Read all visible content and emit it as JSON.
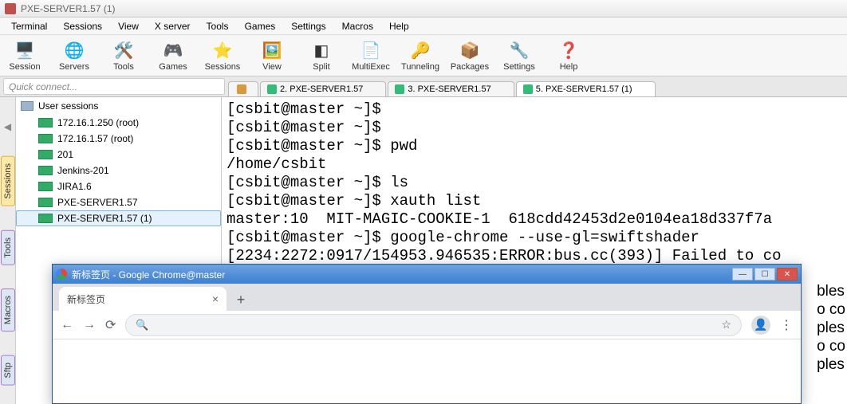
{
  "window": {
    "title": "PXE-SERVER1.57 (1)"
  },
  "menu": [
    "Terminal",
    "Sessions",
    "View",
    "X server",
    "Tools",
    "Games",
    "Settings",
    "Macros",
    "Help"
  ],
  "toolbar": [
    {
      "name": "session",
      "label": "Session",
      "glyph": "🖥️"
    },
    {
      "name": "servers",
      "label": "Servers",
      "glyph": "🌐"
    },
    {
      "name": "tools",
      "label": "Tools",
      "glyph": "🛠️"
    },
    {
      "name": "games",
      "label": "Games",
      "glyph": "🎮"
    },
    {
      "name": "sessions",
      "label": "Sessions",
      "glyph": "⭐"
    },
    {
      "name": "view",
      "label": "View",
      "glyph": "🖼️"
    },
    {
      "name": "split",
      "label": "Split",
      "glyph": "◧"
    },
    {
      "name": "multiexec",
      "label": "MultiExec",
      "glyph": "📄"
    },
    {
      "name": "tunneling",
      "label": "Tunneling",
      "glyph": "🔑"
    },
    {
      "name": "packages",
      "label": "Packages",
      "glyph": "📦"
    },
    {
      "name": "settings",
      "label": "Settings",
      "glyph": "🔧"
    },
    {
      "name": "help",
      "label": "Help",
      "glyph": "❓"
    }
  ],
  "quick_connect_placeholder": "Quick connect...",
  "tabs": [
    {
      "id": "home",
      "label": "",
      "home": true
    },
    {
      "id": "t2",
      "label": "2. PXE-SERVER1.57"
    },
    {
      "id": "t3",
      "label": "3. PXE-SERVER1.57"
    },
    {
      "id": "t5",
      "label": "5. PXE-SERVER1.57 (1)",
      "active": true
    }
  ],
  "sidetabs": [
    "Sessions",
    "Tools",
    "Macros",
    "Sftp"
  ],
  "tree": {
    "head": "User sessions",
    "items": [
      "172.16.1.250 (root)",
      "172.16.1.57 (root)",
      "201",
      "Jenkins-201",
      "JIRA1.6",
      "PXE-SERVER1.57",
      "PXE-SERVER1.57 (1)"
    ],
    "selected_index": 6
  },
  "terminal": {
    "lines": [
      "[csbit@master ~]$",
      "[csbit@master ~]$",
      "[csbit@master ~]$ pwd",
      "/home/csbit",
      "[csbit@master ~]$ ls",
      "[csbit@master ~]$ xauth list",
      "master:10  MIT-MAGIC-COOKIE-1  618cdd42453d2e0104ea18d337f7a",
      "[csbit@master ~]$ google-chrome --use-gl=swiftshader"
    ],
    "partial": "[2234:2272:0917/154953.946535:ERROR:bus.cc(393)] Failed to co",
    "rframes": [
      "bles",
      "o co",
      "ples",
      "o co",
      "ples"
    ]
  },
  "chrome": {
    "title": "新标签页 - Google Chrome@master",
    "tab_label": "新标签页"
  }
}
